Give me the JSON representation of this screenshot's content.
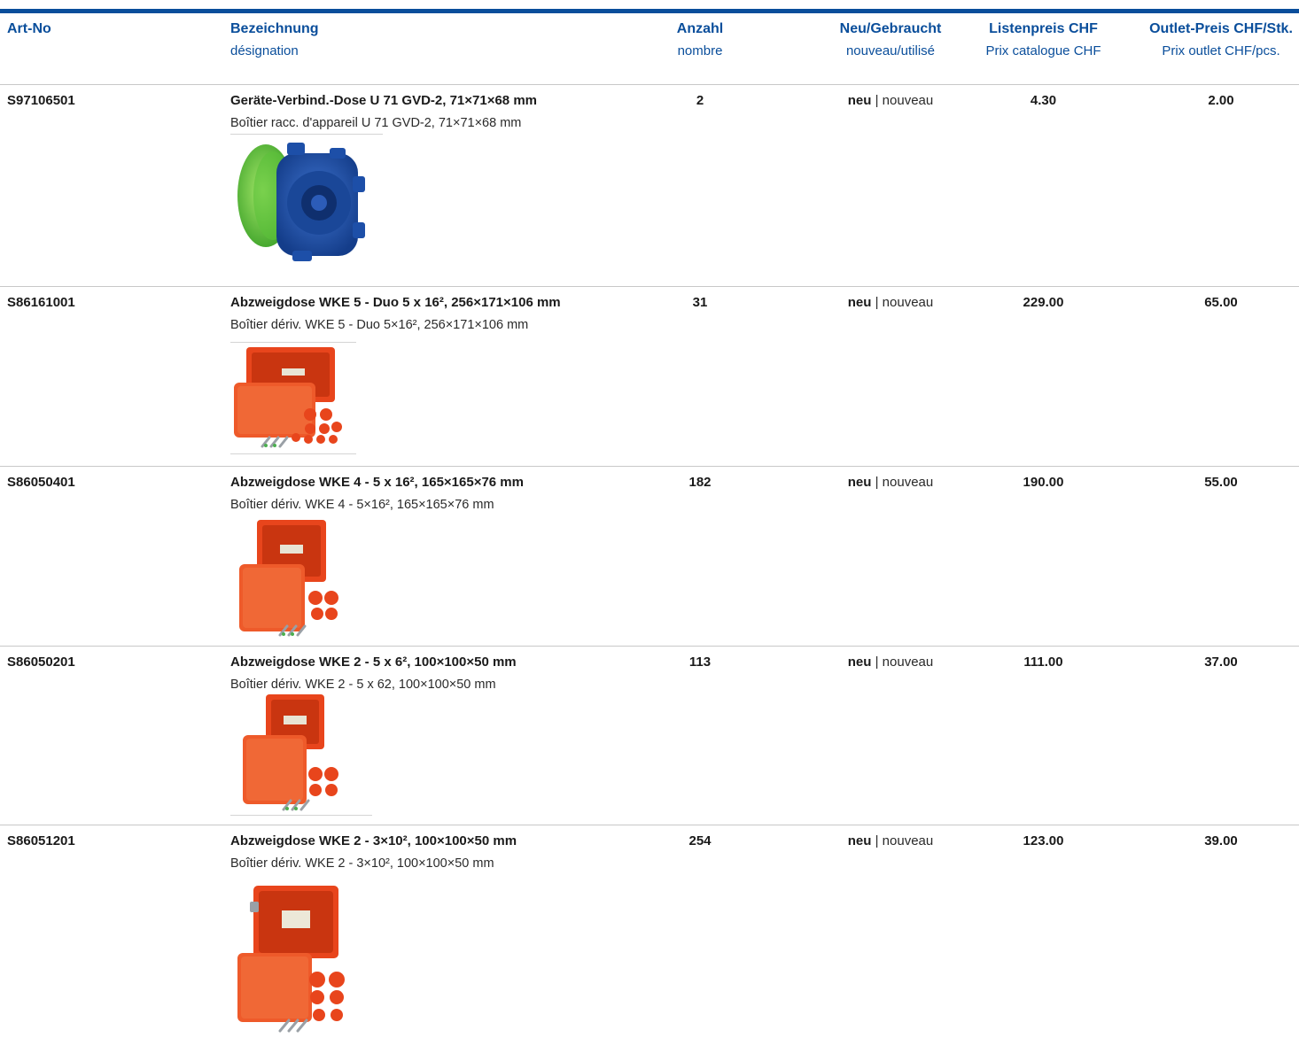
{
  "header": {
    "art_no": "Art-No",
    "bez_de": "Bezeichnung",
    "bez_fr": "désignation",
    "anz_de": "Anzahl",
    "anz_fr": "nombre",
    "neu_de": "Neu/Gebraucht",
    "neu_fr": "nouveau/utilisé",
    "list_de": "Listenpreis CHF",
    "list_fr": "Prix catalogue CHF",
    "out_de": "Outlet-Preis CHF/Stk.",
    "out_fr": "Prix outlet CHF/pcs."
  },
  "colors": {
    "accent": "#0a4e9b",
    "box_red": "#e8451c",
    "box_blue": "#1e4fa6",
    "lid_green": "#6cc93a"
  },
  "rows": [
    {
      "art_no": "S97106501",
      "title": "Geräte-Verbind.-Dose U 71 GVD-2, 71×71×68 mm",
      "subtitle": "Boîtier racc. d'appareil U 71 GVD-2, 71×71×68 mm",
      "qty": "2",
      "cond_de": "neu",
      "cond_fr": "| nouveau",
      "list_price": "4.30",
      "outlet_price": "2.00",
      "image": "blue-box-green-lid-image"
    },
    {
      "art_no": "S86161001",
      "title": "Abzweigdose WKE 5 - Duo 5 x 16², 256×171×106 mm",
      "subtitle": "Boîtier dériv. WKE 5 - Duo 5×16², 256×171×106 mm",
      "qty": "31",
      "cond_de": "neu",
      "cond_fr": "| nouveau",
      "list_price": "229.00",
      "outlet_price": "65.00",
      "image": "red-junction-box-image"
    },
    {
      "art_no": "S86050401",
      "title": "Abzweigdose WKE 4 - 5 x 16², 165×165×76 mm",
      "subtitle": "Boîtier dériv. WKE 4 - 5×16², 165×165×76 mm",
      "qty": "182",
      "cond_de": "neu",
      "cond_fr": "| nouveau",
      "list_price": "190.00",
      "outlet_price": "55.00",
      "image": "red-junction-box-image"
    },
    {
      "art_no": "S86050201",
      "title": "Abzweigdose WKE 2 - 5 x 6², 100×100×50 mm",
      "subtitle": "Boîtier dériv. WKE 2 - 5 x 62, 100×100×50 mm",
      "qty": "113",
      "cond_de": "neu",
      "cond_fr": "| nouveau",
      "list_price": "111.00",
      "outlet_price": "37.00",
      "image": "red-junction-box-image"
    },
    {
      "art_no": "S86051201",
      "title": "Abzweigdose WKE 2 - 3×10², 100×100×50 mm",
      "subtitle": "Boîtier dériv. WKE 2 - 3×10², 100×100×50 mm",
      "qty": "254",
      "cond_de": "neu",
      "cond_fr": "| nouveau",
      "list_price": "123.00",
      "outlet_price": "39.00",
      "image": "red-junction-box-image"
    }
  ]
}
